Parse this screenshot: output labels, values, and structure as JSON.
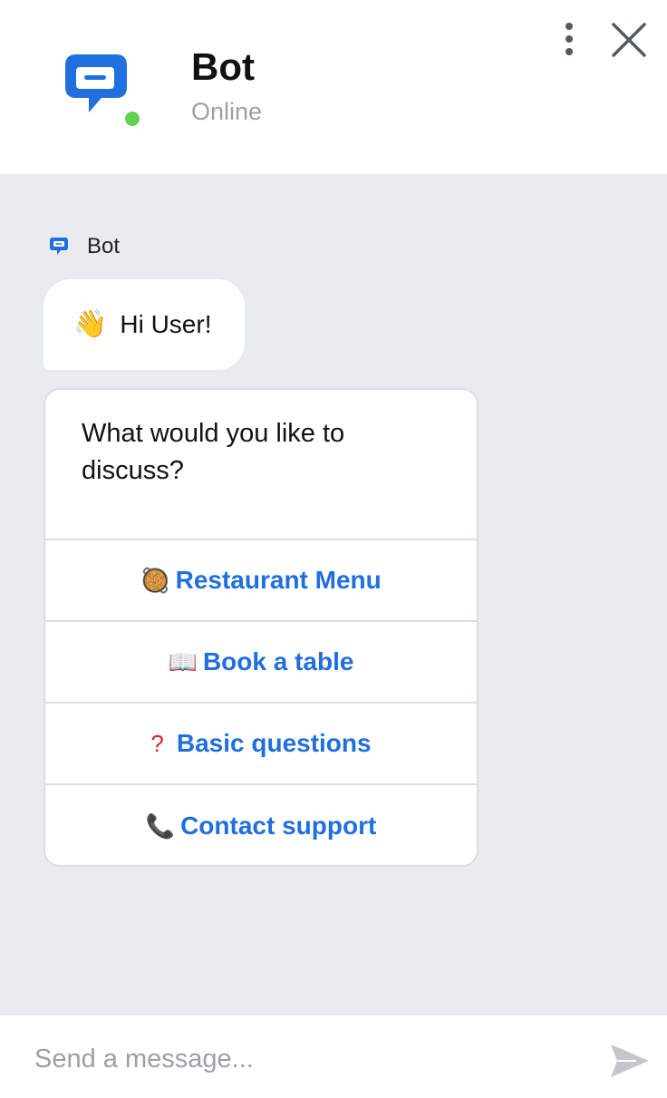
{
  "header": {
    "title": "Bot",
    "status": "Online",
    "logo_icon": "chat-bubble-icon",
    "menu_icon": "more-vertical-icon",
    "close_icon": "close-icon",
    "status_color": "#5fd34f",
    "brand_color": "#1f6fde"
  },
  "chat": {
    "author": "Bot",
    "greeting": {
      "emoji": "👋",
      "text": "Hi User!"
    },
    "card": {
      "question": "What would you like to discuss?",
      "buttons": [
        {
          "emoji": "🥘",
          "label": "Restaurant Menu"
        },
        {
          "emoji": "📖",
          "label": "Book a table"
        },
        {
          "emoji": "?",
          "label": "Basic questions"
        },
        {
          "emoji": "📞",
          "label": "Contact support"
        }
      ]
    }
  },
  "composer": {
    "placeholder": "Send a message...",
    "value": "",
    "send_icon": "send-icon"
  }
}
